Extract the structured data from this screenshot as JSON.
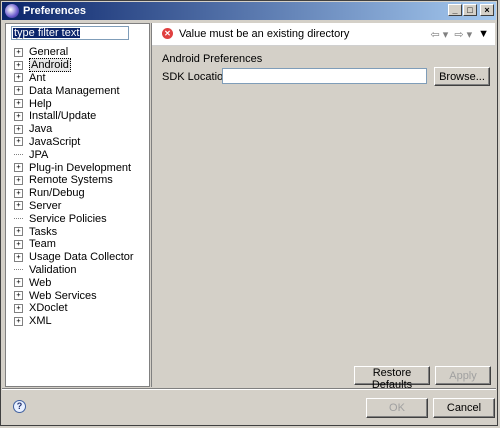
{
  "window": {
    "title": "Preferences",
    "buttons": {
      "minimize": "_",
      "maximize": "□",
      "close": "×"
    }
  },
  "filter": {
    "value": "type filter text"
  },
  "tree": {
    "items": [
      {
        "label": "General",
        "expandable": true
      },
      {
        "label": "Android",
        "expandable": true,
        "selected": true
      },
      {
        "label": "Ant",
        "expandable": true
      },
      {
        "label": "Data Management",
        "expandable": true
      },
      {
        "label": "Help",
        "expandable": true
      },
      {
        "label": "Install/Update",
        "expandable": true
      },
      {
        "label": "Java",
        "expandable": true
      },
      {
        "label": "JavaScript",
        "expandable": true
      },
      {
        "label": "JPA",
        "expandable": false
      },
      {
        "label": "Plug-in Development",
        "expandable": true
      },
      {
        "label": "Remote Systems",
        "expandable": true
      },
      {
        "label": "Run/Debug",
        "expandable": true
      },
      {
        "label": "Server",
        "expandable": true
      },
      {
        "label": "Service Policies",
        "expandable": false
      },
      {
        "label": "Tasks",
        "expandable": true
      },
      {
        "label": "Team",
        "expandable": true
      },
      {
        "label": "Usage Data Collector",
        "expandable": true
      },
      {
        "label": "Validation",
        "expandable": false
      },
      {
        "label": "Web",
        "expandable": true
      },
      {
        "label": "Web Services",
        "expandable": true
      },
      {
        "label": "XDoclet",
        "expandable": true
      },
      {
        "label": "XML",
        "expandable": true
      }
    ]
  },
  "page": {
    "error_message": "Value must be an existing directory",
    "error_icon": "error-icon",
    "nav": {
      "back": "⇦ ▾",
      "forward": "⇨ ▾",
      "menu": "▼"
    },
    "section_title": "Android Preferences",
    "sdk_label": "SDK Location:",
    "sdk_value": "",
    "browse_label": "Browse...",
    "restore_label": "Restore Defaults",
    "apply_label": "Apply"
  },
  "footer": {
    "help_icon": "?",
    "ok_label": "OK",
    "cancel_label": "Cancel"
  },
  "colors": {
    "titlebar_start": "#0a246a",
    "titlebar_end": "#a6caf0",
    "error": "#e04040"
  }
}
